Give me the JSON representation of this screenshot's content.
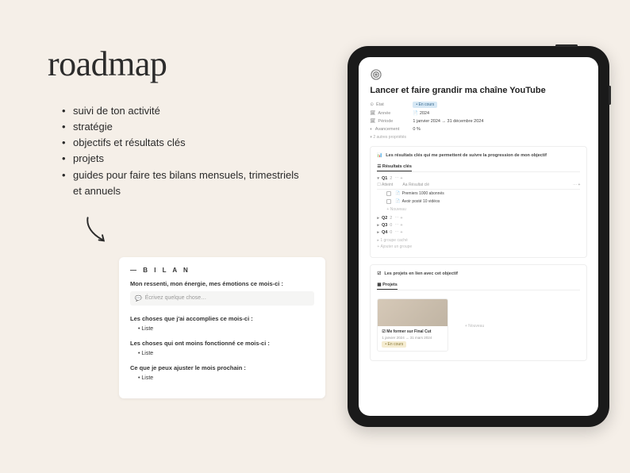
{
  "heading": "roadmap",
  "features": [
    "suivi de ton activité",
    "stratégie",
    "objectifs et résultats clés",
    "projets",
    "guides pour faire tes bilans mensuels, trimestriels et annuels"
  ],
  "bilan": {
    "title": "— B I L A N",
    "prompt1": "Mon ressenti, mon énergie, mes émotions ce mois-ci :",
    "input_placeholder": "Écrivez quelque chose…",
    "prompt2": "Les choses que j'ai accomplies ce mois-ci :",
    "list_item": "Liste",
    "prompt3": "Les choses qui ont moins fonctionné ce mois-ci :",
    "prompt4": "Ce que je peux ajuster le mois prochain :"
  },
  "doc": {
    "title": "Lancer et faire grandir ma chaîne YouTube",
    "props": {
      "etat_label": "État",
      "etat_value": "• En cours",
      "annee_label": "Année",
      "annee_value": "2024",
      "periode_label": "Période",
      "periode_value": "1 janvier 2024 → 31 décembre 2024",
      "avancement_label": "Avancement",
      "avancement_value": "0 %"
    },
    "more_props": "2 autres propriétés",
    "results": {
      "heading": "Les résultats clés qui me permettent de suivre la progression de mon objectif",
      "tab": "Résultats clés",
      "col_atteint": "Atteint",
      "col_resultat": "Résultat clé",
      "quarters": [
        {
          "label": "Q1",
          "count": "2",
          "open": true
        },
        {
          "label": "Q2",
          "count": "2",
          "open": false
        },
        {
          "label": "Q3",
          "count": "0",
          "open": false
        },
        {
          "label": "Q4",
          "count": "0",
          "open": false
        }
      ],
      "kr1": "Premiers 1000 abonnés",
      "kr2": "Avoir posté 10 vidéos",
      "new": "+ Nouveau",
      "hidden_group": "1 groupe caché",
      "add_group": "+ Ajouter un groupe"
    },
    "projects": {
      "heading": "Les projets en lien avec cet objectif",
      "tab": "Projets",
      "card": {
        "title": "Me former sur Final Cut",
        "date": "1 janvier 2024 → 31 mars 2024",
        "status": "• En cours"
      },
      "add": "+ Nouveau"
    }
  }
}
